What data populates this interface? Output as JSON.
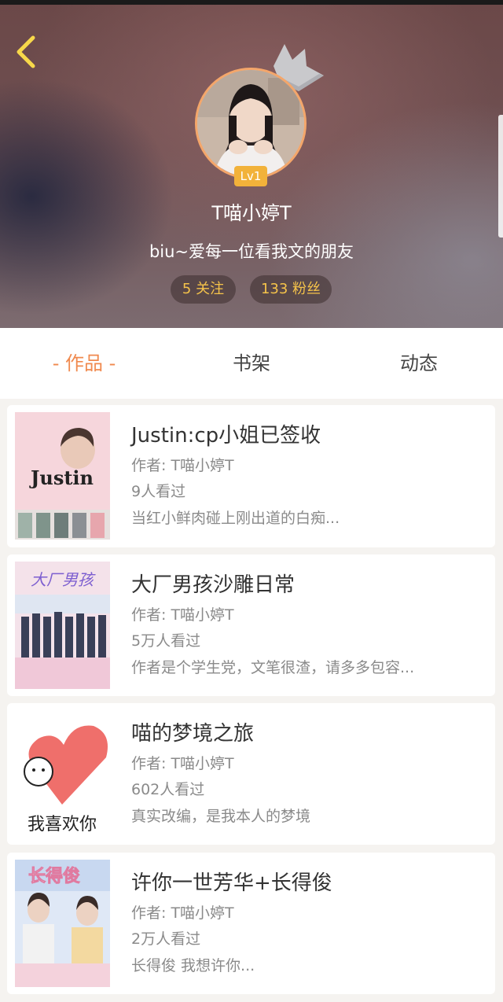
{
  "profile": {
    "username": "T喵小婷T",
    "bio": "biu~爱每一位看我文的朋友",
    "level": "Lv1",
    "following": "5 关注",
    "fans": "133 粉丝"
  },
  "tabs": [
    {
      "label": "- 作品 -"
    },
    {
      "label": "书架"
    },
    {
      "label": "动态"
    }
  ],
  "books": [
    {
      "title": "Justin:cp小姐已签收",
      "author": "作者: T喵小婷T",
      "views": "9人看过",
      "desc": "当红小鲜肉碰上刚出道的白痴...",
      "cover_text": "Justin"
    },
    {
      "title": "大厂男孩沙雕日常",
      "author": "作者: T喵小婷T",
      "views": "5万人看过",
      "desc": "作者是个学生党，文笔很渣，请多多包容...",
      "cover_text": "大厂男孩"
    },
    {
      "title": "喵的梦境之旅",
      "author": "作者: T喵小婷T",
      "views": "602人看过",
      "desc": "真实改编，是我本人的梦境",
      "cover_text": "我喜欢你"
    },
    {
      "title": "许你一世芳华+长得俊",
      "author": "作者: T喵小婷T",
      "views": "2万人看过",
      "desc": "长得俊 我想许你...",
      "cover_text": "长得俊"
    }
  ],
  "colors": {
    "accent": "#f08a4f",
    "gold": "#f5c34a",
    "badge": "#f2b23a"
  }
}
